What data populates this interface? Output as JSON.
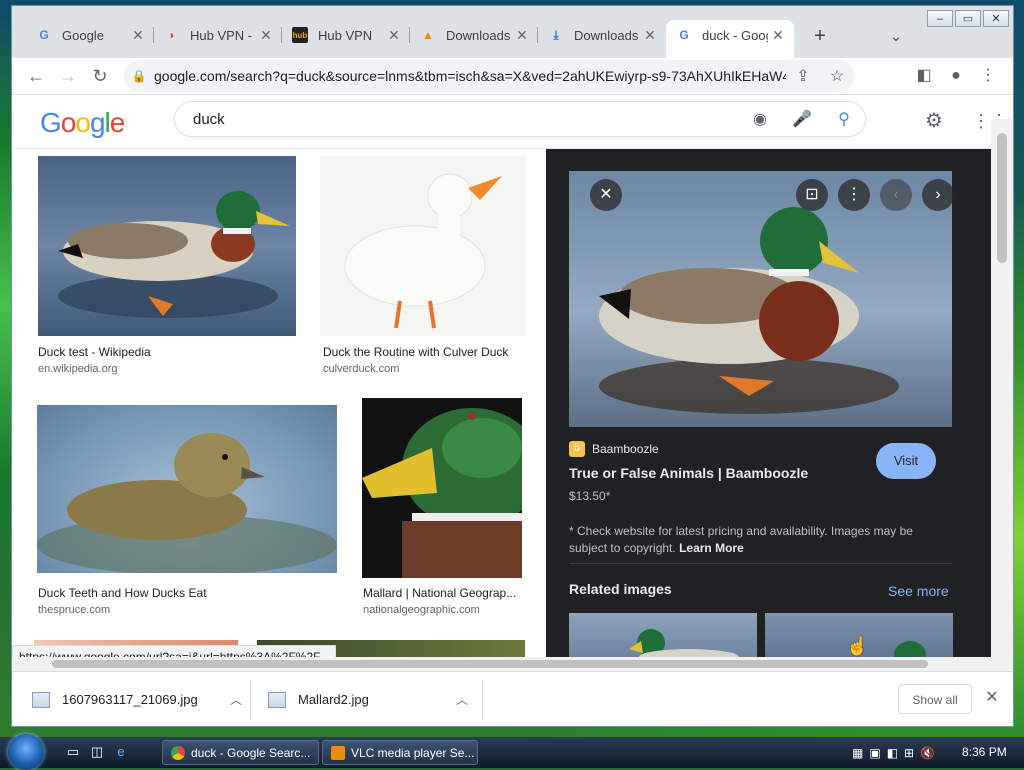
{
  "browser": {
    "tabs": [
      {
        "label": "Google",
        "icon": "google-g-icon"
      },
      {
        "label": "Hub VPN - ",
        "icon": "hubvpn-icon"
      },
      {
        "label": "Hub VPN",
        "icon": "hub-icon"
      },
      {
        "label": "Downloads",
        "icon": "vlc-cone-icon"
      },
      {
        "label": "Downloads",
        "icon": "download-arrow-icon"
      },
      {
        "label": "duck - Goog",
        "icon": "google-g-icon"
      }
    ],
    "url": "google.com/search?q=duck&source=lnms&tbm=isch&sa=X&ved=2ahUKEwiyrp-s9-73AhXUhIkEHaW4CPE...",
    "status_url": "https://www.google.com/url?sa=i&url=https%3A%2F%2F..."
  },
  "google": {
    "logo": "Google",
    "query": "duck"
  },
  "results": [
    {
      "caption": "Duck test - Wikipedia",
      "source": "en.wikipedia.org"
    },
    {
      "caption": "Duck the Routine with Culver Duck",
      "source": "culverduck.com"
    },
    {
      "caption": "Duck Teeth and How Ducks Eat",
      "source": "thespruce.com"
    },
    {
      "caption": "Mallard | National Geograp...",
      "source": "nationalgeographic.com"
    }
  ],
  "panel": {
    "site": "Baamboozle",
    "title": "True or False Animals | Baamboozle",
    "price": "$13.50*",
    "visit_label": "Visit",
    "note": "* Check website for latest pricing and availability. Images may be subject to copyright.",
    "learn_more": "Learn More",
    "related_label": "Related images",
    "see_more": "See more"
  },
  "downloads": {
    "items": [
      {
        "name": "1607963117_21069.jpg"
      },
      {
        "name": "Mallard2.jpg"
      }
    ],
    "show_all": "Show all"
  },
  "taskbar": {
    "tasks": [
      {
        "label": "duck - Google Searc..."
      },
      {
        "label": "VLC media player Se..."
      }
    ],
    "clock": "8:36 PM"
  },
  "colors": {
    "google_blue": "#4285f4",
    "google_red": "#ea4335",
    "google_yellow": "#fbbc05",
    "google_green": "#34a853",
    "link_blue": "#8ab4f8",
    "panel_bg": "#202124"
  }
}
